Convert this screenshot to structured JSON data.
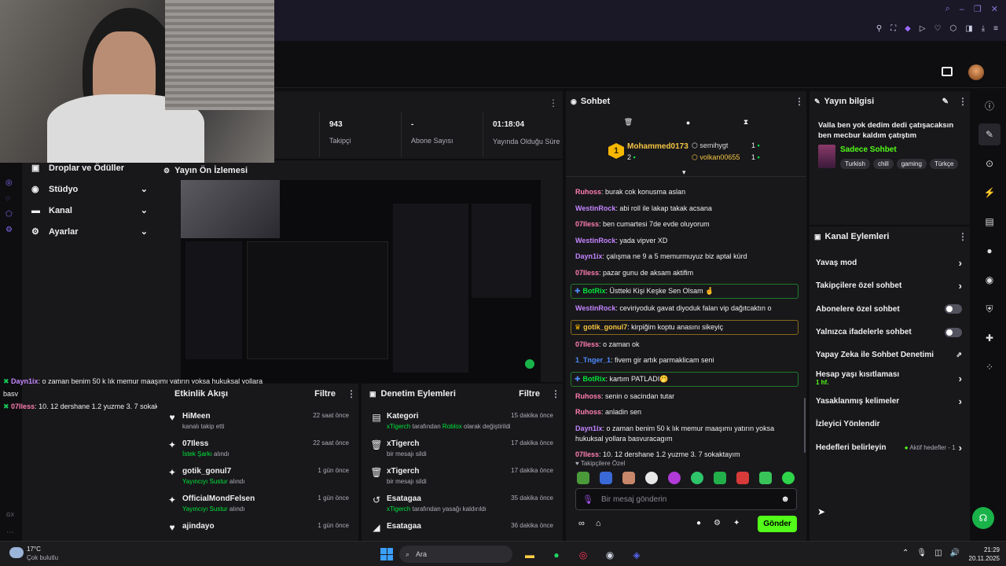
{
  "stats": [
    {
      "value": "943",
      "label": "Takipçi"
    },
    {
      "value": "-",
      "label": "Abone Sayısı"
    },
    {
      "value": "01:18:04",
      "label": "Yayında Olduğu Süre"
    }
  ],
  "left_nav": {
    "items": [
      {
        "label": "Droplar ve Ödüller"
      },
      {
        "label": "Stüdyo"
      },
      {
        "label": "Kanal"
      },
      {
        "label": "Ayarlar"
      }
    ],
    "side_label": "GX"
  },
  "preview": {
    "title": "Yayın Ön İzlemesi"
  },
  "overlay_chat": [
    {
      "user": "Dayn1ix",
      "text": ": o zaman benim 50 k lık memur maaşımı yatırın yoksa hukuksal yollara basv"
    },
    {
      "user": "07Iless",
      "text": ": 10. 12 dershane 1.2 yuzme 3. 7 sokaktayım"
    }
  ],
  "activity": {
    "title": "Etkinlik Akışı",
    "filter": "Filtre",
    "items": [
      {
        "name": "HiMeen",
        "sub_plain": "kanalı takip etti",
        "sub_green": "",
        "sub_after": "",
        "time": "22 saat önce",
        "icon": "♥"
      },
      {
        "name": "07Iless",
        "sub_plain": "",
        "sub_green": "İstek Şarkı",
        "sub_after": " alındı",
        "time": "22 saat önce",
        "icon": "✦"
      },
      {
        "name": "gotik_gonul7",
        "sub_plain": "",
        "sub_green": "Yayıncıyı Sustur",
        "sub_after": " alındı",
        "time": "1 gün önce",
        "icon": "✦"
      },
      {
        "name": "OfficialMondFelsen",
        "sub_plain": "",
        "sub_green": "Yayıncıyı Sustur",
        "sub_after": " alındı",
        "time": "1 gün önce",
        "icon": "✦"
      },
      {
        "name": "ajindayo",
        "sub_plain": "",
        "sub_green": "",
        "sub_after": "",
        "time": "1 gün önce",
        "icon": "♥"
      }
    ]
  },
  "moderation": {
    "title": "Denetim Eylemleri",
    "filter": "Filtre",
    "items": [
      {
        "name": "Kategori",
        "pre_green": "xTigerch",
        "mid": " tarafından ",
        "green2": "Roblox",
        "after": " olarak değiştirildi",
        "time": "15 dakika önce",
        "icon": "▤"
      },
      {
        "name": "xTigerch",
        "pre_green": "",
        "mid": "bir mesajı sildi",
        "green2": "",
        "after": "",
        "time": "17 dakika önce",
        "icon": "🗑"
      },
      {
        "name": "xTigerch",
        "pre_green": "",
        "mid": "bir mesajı sildi",
        "green2": "",
        "after": "",
        "time": "17 dakika önce",
        "icon": "🗑"
      },
      {
        "name": "Esatagaa",
        "pre_green": "xTigerch",
        "mid": " tarafından yasağı kaldırıldı",
        "green2": "",
        "after": "",
        "time": "35 dakika önce",
        "icon": "↺"
      },
      {
        "name": "Esatagaa",
        "pre_green": "",
        "mid": "",
        "green2": "",
        "after": "",
        "time": "36 dakika önce",
        "icon": "◢"
      }
    ]
  },
  "chat": {
    "title": "Sohbet",
    "leaderboard": {
      "first_name": "Mohammed0173",
      "first_count": "2",
      "rank": "1",
      "others": [
        {
          "name": "semihygt",
          "count": "1"
        },
        {
          "name": "volkan00655",
          "count": "1"
        }
      ]
    },
    "messages": [
      {
        "user": "Ruhoss",
        "color": "#ff7eb0",
        "text": ": burak cok konusma aslan",
        "box": false
      },
      {
        "user": "WestinRock",
        "color": "#c586ff",
        "text": ": abi roll ile lakap takak acsana",
        "box": false
      },
      {
        "user": "07Iless",
        "color": "#ff7eb0",
        "text": ": ben cumartesi 7de evde oluyorum",
        "box": false
      },
      {
        "user": "WestinRock",
        "color": "#c586ff",
        "text": ": yada vipver XD",
        "box": false
      },
      {
        "user": "Dayn1ix",
        "color": "#c586ff",
        "text": ": çalışma ne 9 a 5 memurmuyuz biz aptal kürd",
        "box": false
      },
      {
        "user": "07Iless",
        "color": "#ff7eb0",
        "text": ": pazar gunu de aksam aktifim",
        "box": false
      },
      {
        "user": "BotRix",
        "color": "#00e63a",
        "text": ": Üstteki Kişi Keşke Sen Olsam 🤞",
        "box": "green"
      },
      {
        "user": "WestinRock",
        "color": "#c586ff",
        "text": ": ceviriyoduk gavat diyoduk falan vip dağıtcaktın o",
        "box": false
      },
      {
        "user": "gotik_gonul7",
        "color": "#f5c542",
        "text": ": kirpiğim koptu anasını sikeyiç",
        "box": "gold"
      },
      {
        "user": "07Iless",
        "color": "#ff7eb0",
        "text": ": o zaman ok",
        "box": false
      },
      {
        "user": "1_Tnger_1",
        "color": "#4f8cff",
        "text": ": fivem gir artık parmaklicam seni",
        "box": false
      },
      {
        "user": "BotRix",
        "color": "#00e63a",
        "text": ": kartım PATLADI🤭",
        "box": "green"
      },
      {
        "user": "Ruhoss",
        "color": "#ff7eb0",
        "text": ": senin o sacindan tutar",
        "box": false
      },
      {
        "user": "Ruhoss",
        "color": "#ff7eb0",
        "text": ": anladin sen",
        "box": false
      },
      {
        "user": "Dayn1ix",
        "color": "#c586ff",
        "text": ": o zaman benim 50 k lık memur maaşımı yatırın yoksa hukuksal yollara basvuracagım",
        "box": false
      },
      {
        "user": "07Iless",
        "color": "#ff7eb0",
        "text": ": 10. 12 dershane 1.2 yuzme 3. 7 sokaktayım",
        "box": false
      }
    ],
    "emote_label": "Takipçilere Özel",
    "input_placeholder": "Bir mesaj gönderin",
    "send_label": "Gönder"
  },
  "stream_info": {
    "title": "Yayın bilgisi",
    "stream_title": "Valla ben yok dedim dedi çatışacaksın ben mecbur kaldım çatıştım",
    "category": "Sadece Sohbet",
    "tags": [
      "Turkish",
      "chill",
      "gaming",
      "Türkçe"
    ]
  },
  "channel_actions": {
    "title": "Kanal Eylemleri",
    "slow_mode": "Yavaş mod",
    "followers_only": "Takipçilere özel sohbet",
    "subscribers_only": "Abonelere özel sohbet",
    "emotes_only": "Yalnızca ifadelerle sohbet",
    "ai_moderation": "Yapay Zeka ile Sohbet Denetimi",
    "age_restriction": "Hesap yaşı kısıtlaması",
    "age_value": "1 hf.",
    "banned_words": "Yasaklanmış kelimeler",
    "raid": "İzleyici Yönlendir",
    "goals": "Hedefleri belirleyin",
    "active_goals": "Aktif hedefler - 1"
  },
  "taskbar": {
    "temp": "17°C",
    "weather": "Çok bulutlu",
    "search": "Ara",
    "time": "21:29",
    "date": "20.11.2025"
  },
  "colors": {
    "accent": "#53fc18",
    "bg": "#0e0e10",
    "panel": "#18181b"
  }
}
